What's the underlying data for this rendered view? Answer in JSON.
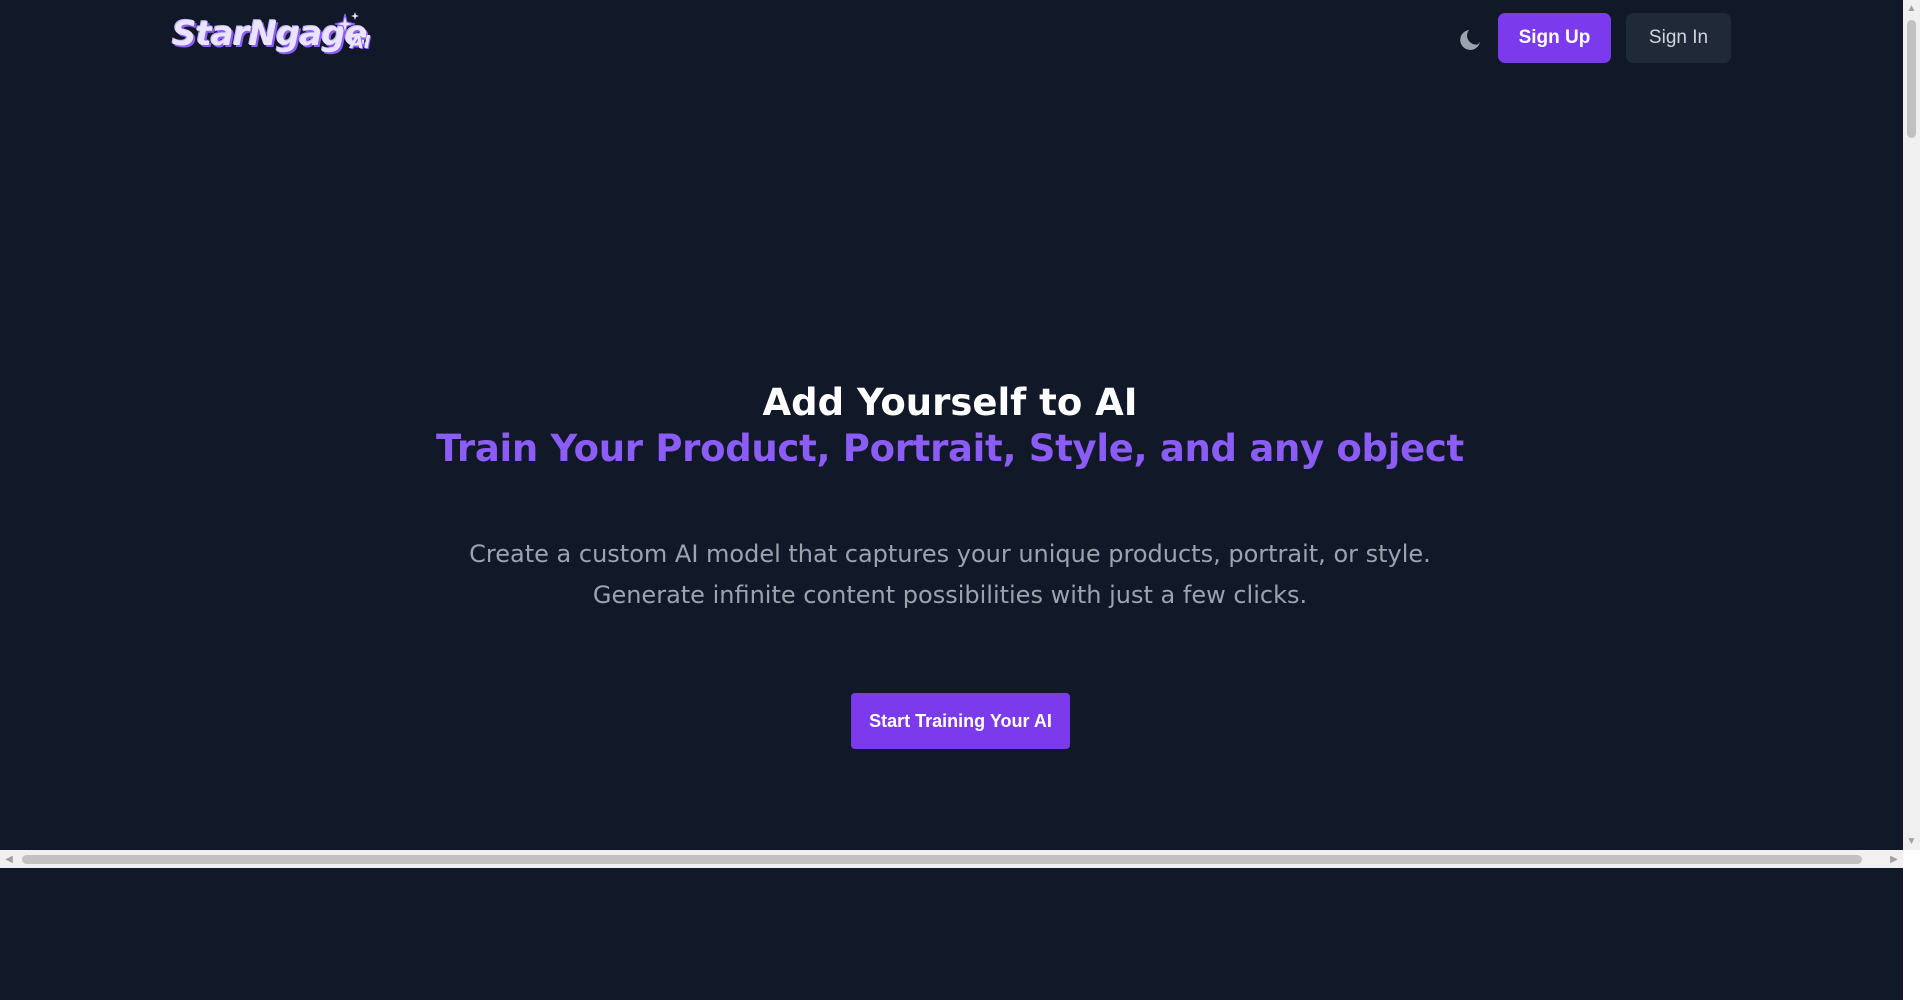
{
  "header": {
    "logo_text": "StarNgage",
    "logo_suffix": "AI",
    "theme_toggle_icon": "moon-icon",
    "signup_label": "Sign Up",
    "signin_label": "Sign In"
  },
  "hero": {
    "title": "Add Yourself to AI",
    "subtitle": "Train Your Product, Portrait, Style, and any object",
    "description_line1": "Create a custom AI model that captures your unique products, portrait, or style.",
    "description_line2": "Generate infinite content possibilities with just a few clicks.",
    "cta_label": "Start Training Your AI"
  },
  "colors": {
    "background": "#111827",
    "accent": "#7c3aed",
    "accent_text": "#8b5cf6",
    "secondary_button": "#1f2937",
    "muted_text": "#9ca3af"
  }
}
